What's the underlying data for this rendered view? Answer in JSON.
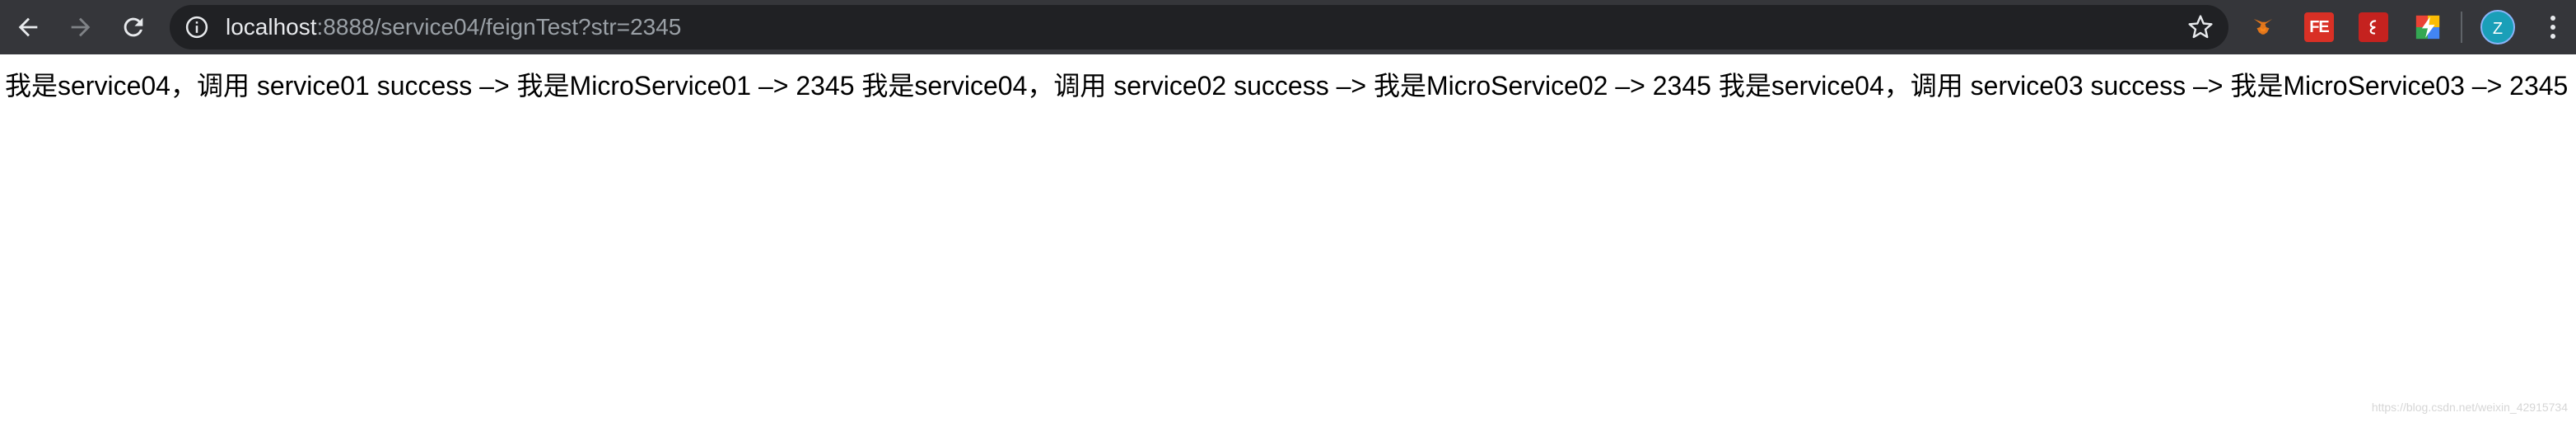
{
  "toolbar": {
    "url_host": "localhost",
    "url_rest": ":8888/service04/feignTest?str=2345",
    "avatar_letter": "Z",
    "fe_extension_label": "FE"
  },
  "icons": {
    "back": "arrow-left-icon",
    "forward": "arrow-right-icon",
    "reload": "reload-icon",
    "info": "info-icon",
    "bookmark": "star-icon",
    "menu": "kebab-menu-icon"
  },
  "colors": {
    "toolbar_bg": "#35363a",
    "omnibox_bg": "#202124",
    "avatar_bg": "#1a9fb8"
  },
  "page": {
    "response_text": "我是service04，调用 service01 success –> 我是MicroService01 –> 2345 我是service04，调用 service02 success –> 我是MicroService02 –> 2345 我是service04，调用 service03 success –> 我是MicroService03 –> 2345",
    "watermark": "https://blog.csdn.net/weixin_42915734"
  }
}
